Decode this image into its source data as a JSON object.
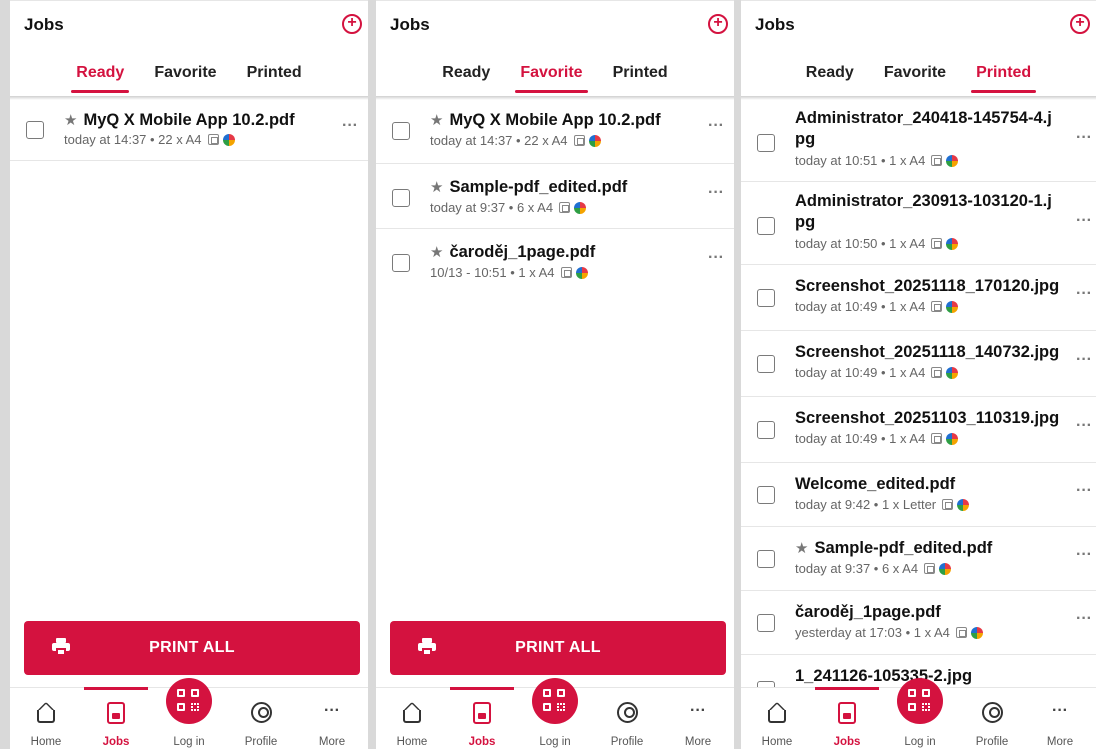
{
  "colors": {
    "accent": "#d4123f"
  },
  "screens": [
    {
      "title": "Jobs",
      "tabs": [
        "Ready",
        "Favorite",
        "Printed"
      ],
      "active_tab": "Ready",
      "jobs": [
        {
          "starred": true,
          "name": "MyQ X Mobile App 10.2.pdf",
          "meta": "today at 14:37 • 22 x A4"
        }
      ],
      "print_all_label": "PRINT ALL",
      "nav": [
        "Home",
        "Jobs",
        "Log in",
        "Profile",
        "More"
      ]
    },
    {
      "title": "Jobs",
      "tabs": [
        "Ready",
        "Favorite",
        "Printed"
      ],
      "active_tab": "Favorite",
      "jobs": [
        {
          "starred": true,
          "name": "MyQ X Mobile App 10.2.pdf",
          "meta": "today at 14:37 • 22 x A4"
        },
        {
          "starred": true,
          "name": "Sample-pdf_edited.pdf",
          "meta": "today at 9:37 • 6 x A4"
        },
        {
          "starred": true,
          "name": "čaroděj_1page.pdf",
          "meta": "10/13 - 10:51 • 1 x A4"
        }
      ],
      "print_all_label": "PRINT ALL",
      "nav": [
        "Home",
        "Jobs",
        "Log in",
        "Profile",
        "More"
      ]
    },
    {
      "title": "Jobs",
      "tabs": [
        "Ready",
        "Favorite",
        "Printed"
      ],
      "active_tab": "Printed",
      "jobs": [
        {
          "starred": false,
          "name": "Administrator_240418-145754-4.jpg",
          "meta": "today at 10:51 • 1 x A4"
        },
        {
          "starred": false,
          "name": "Administrator_230913-103120-1.jpg",
          "meta": "today at 10:50 • 1 x A4"
        },
        {
          "starred": false,
          "name": "Screenshot_20251118_170120.jpg",
          "meta": "today at 10:49 • 1 x A4"
        },
        {
          "starred": false,
          "name": "Screenshot_20251118_140732.jpg",
          "meta": "today at 10:49 • 1 x A4"
        },
        {
          "starred": false,
          "name": "Screenshot_20251103_110319.jpg",
          "meta": "today at 10:49 • 1 x A4"
        },
        {
          "starred": false,
          "name": "Welcome_edited.pdf",
          "meta": "today at 9:42 • 1 x Letter"
        },
        {
          "starred": true,
          "name": "Sample-pdf_edited.pdf",
          "meta": "today at 9:37 • 6 x A4"
        },
        {
          "starred": false,
          "name": "čaroděj_1page.pdf",
          "meta": "yesterday at 17:03 • 1 x A4"
        },
        {
          "starred": false,
          "name": "1_241126-105335-2.jpg",
          "meta": ""
        }
      ],
      "print_all_label": "",
      "nav": [
        "Home",
        "Jobs",
        "Log in",
        "Profile",
        "More"
      ]
    }
  ]
}
